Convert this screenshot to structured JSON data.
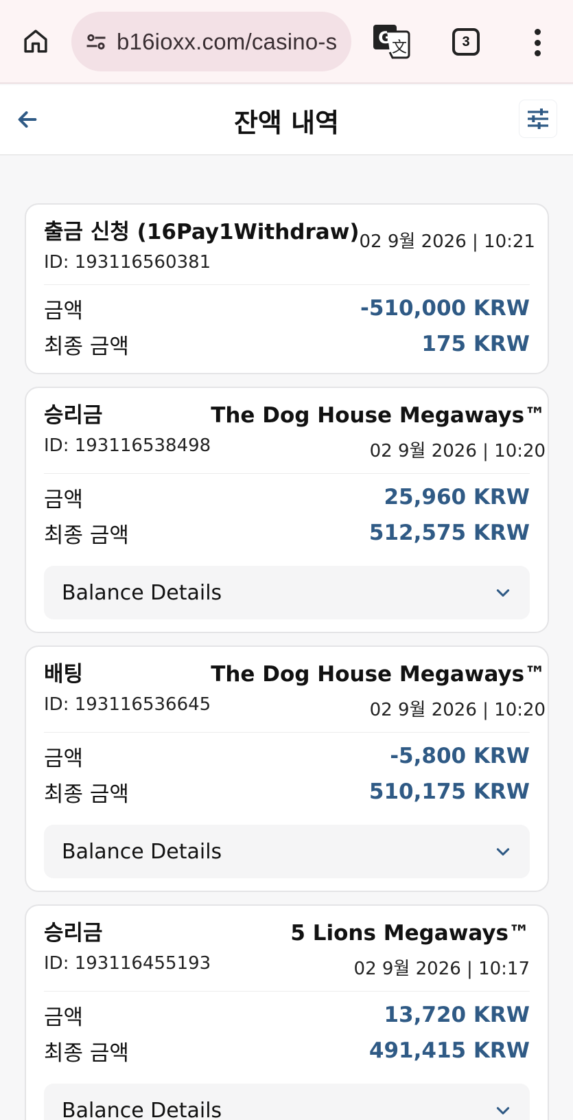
{
  "browser": {
    "url": "b16ioxx.com/casino-s",
    "tab_count": "3"
  },
  "header": {
    "title": "잔액 내역"
  },
  "transactions": [
    {
      "type": "출금 신청 (16Pay1Withdraw)",
      "id": "ID: 193116560381",
      "game": "",
      "date": "02 9월 2026 | 10:21",
      "amount_label": "금액",
      "amount": "-510,000 KRW",
      "final_label": "최종 금액",
      "final": "175 KRW"
    },
    {
      "type": "승리금",
      "id": "ID: 193116538498",
      "game": "The Dog House Megaways™",
      "date": "02 9월 2026 | 10:20",
      "amount_label": "금액",
      "amount": "25,960 KRW",
      "final_label": "최종 금액",
      "final": "512,575 KRW",
      "details_label": "Balance Details"
    },
    {
      "type": "배팅",
      "id": "ID: 193116536645",
      "game": "The Dog House Megaways™",
      "date": "02 9월 2026 | 10:20",
      "amount_label": "금액",
      "amount": "-5,800 KRW",
      "final_label": "최종 금액",
      "final": "510,175 KRW",
      "details_label": "Balance Details"
    },
    {
      "type": "승리금",
      "id": "ID: 193116455193",
      "game": "5 Lions Megaways™",
      "date": "02 9월 2026 | 10:17",
      "amount_label": "금액",
      "amount": "13,720 KRW",
      "final_label": "최종 금액",
      "final": "491,415 KRW",
      "details_label": "Balance Details"
    }
  ],
  "icons": {
    "home": "home-icon",
    "site_settings": "tune-icon",
    "translate": "translate-icon",
    "tabs": "tabs-icon",
    "menu": "more-vert-icon",
    "back": "arrow-back-icon",
    "filter": "filter-sliders-icon",
    "expand": "chevron-down-icon"
  },
  "colors": {
    "accent": "#2f5a85",
    "browser_bar": "#fdf4f5",
    "url_pill": "#f3e1e6"
  }
}
